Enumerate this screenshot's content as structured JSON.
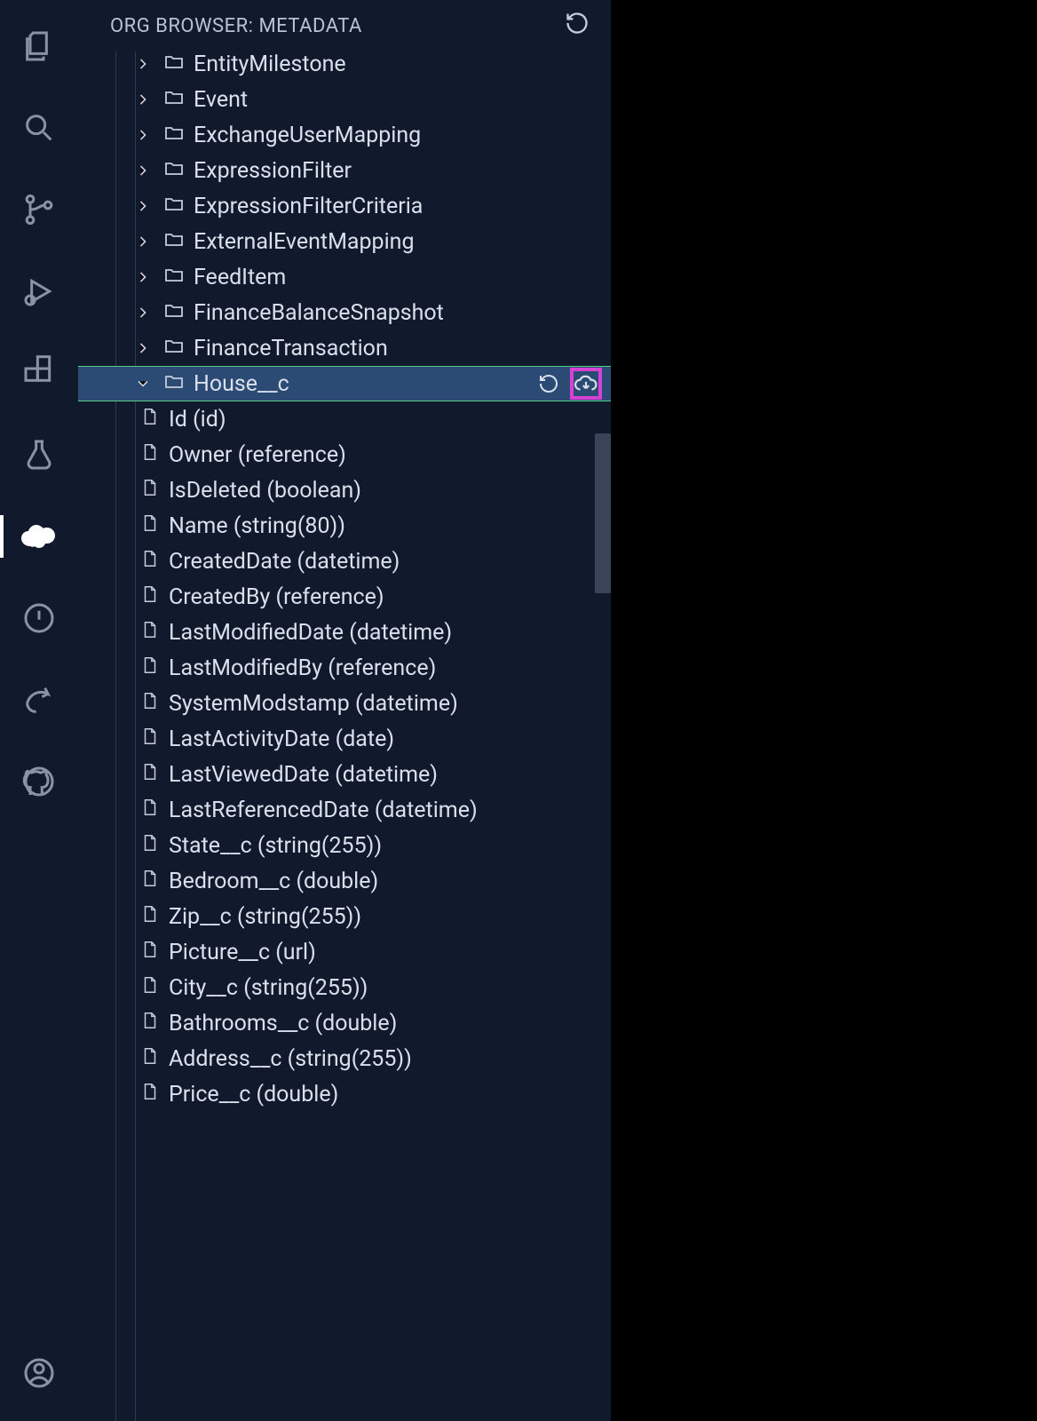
{
  "panel": {
    "title": "ORG BROWSER: METADATA"
  },
  "activityBar": {
    "items": [
      {
        "name": "explorer-icon"
      },
      {
        "name": "search-icon"
      },
      {
        "name": "source-control-icon"
      },
      {
        "name": "run-debug-icon"
      },
      {
        "name": "extensions-icon"
      },
      {
        "name": "testing-icon"
      },
      {
        "name": "salesforce-icon",
        "active": true
      },
      {
        "name": "issues-icon"
      },
      {
        "name": "share-icon"
      },
      {
        "name": "github-icon"
      }
    ],
    "bottom": [
      {
        "name": "accounts-icon"
      }
    ]
  },
  "tree": {
    "folders": [
      {
        "label": "EntityMilestone",
        "expanded": false
      },
      {
        "label": "Event",
        "expanded": false
      },
      {
        "label": "ExchangeUserMapping",
        "expanded": false
      },
      {
        "label": "ExpressionFilter",
        "expanded": false
      },
      {
        "label": "ExpressionFilterCriteria",
        "expanded": false
      },
      {
        "label": "ExternalEventMapping",
        "expanded": false
      },
      {
        "label": "FeedItem",
        "expanded": false
      },
      {
        "label": "FinanceBalanceSnapshot",
        "expanded": false
      },
      {
        "label": "FinanceTransaction",
        "expanded": false
      },
      {
        "label": "House__c",
        "expanded": true,
        "selected": true
      }
    ],
    "expandedFields": [
      {
        "label": "Id (id)"
      },
      {
        "label": "Owner (reference)"
      },
      {
        "label": "IsDeleted (boolean)"
      },
      {
        "label": "Name (string(80))"
      },
      {
        "label": "CreatedDate (datetime)"
      },
      {
        "label": "CreatedBy (reference)"
      },
      {
        "label": "LastModifiedDate (datetime)"
      },
      {
        "label": "LastModifiedBy (reference)"
      },
      {
        "label": "SystemModstamp (datetime)"
      },
      {
        "label": "LastActivityDate (date)"
      },
      {
        "label": "LastViewedDate (datetime)"
      },
      {
        "label": "LastReferencedDate (datetime)"
      },
      {
        "label": "State__c (string(255))"
      },
      {
        "label": "Bedroom__c (double)"
      },
      {
        "label": "Zip__c (string(255))"
      },
      {
        "label": "Picture__c (url)"
      },
      {
        "label": "City__c (string(255))"
      },
      {
        "label": "Bathrooms__c (double)"
      },
      {
        "label": "Address__c (string(255))"
      },
      {
        "label": "Price__c (double)"
      }
    ]
  }
}
